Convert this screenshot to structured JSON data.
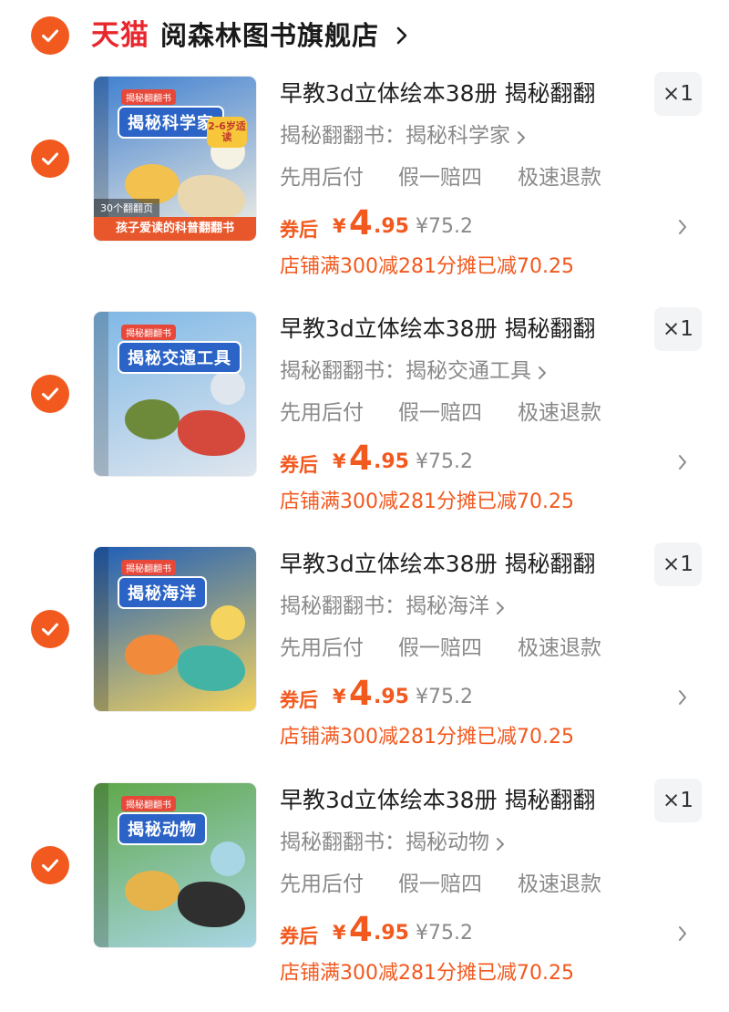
{
  "store": {
    "brand_logo_text": "天猫",
    "name": "阅森林图书旗舰店",
    "chevron": "chevron-right-icon",
    "checked": true
  },
  "colors": {
    "accent": "#f2591f",
    "brand_red": "#e8262d",
    "muted_text": "#8a8a8a",
    "qty_bg": "#f3f4f6"
  },
  "items": [
    {
      "checked": true,
      "title": "早教3d立体绘本38册 揭秘翻翻",
      "quantity": "×1",
      "sku": "揭秘翻翻书：揭秘科学家",
      "services": [
        "先用后付",
        "假一赔四",
        "极速退款"
      ],
      "coupon_label": "券后",
      "currency": "¥",
      "price_int": "4",
      "price_dec": ".95",
      "original_price": "¥75.2",
      "promo": "店铺满300减281分摊已减70.25",
      "cover": {
        "title": "揭秘科学家",
        "mini_tag": "揭秘翻翻书",
        "badge": "2-6岁适读",
        "ribbon_top": "30个翻翻页",
        "ribbon_bottom": "孩子爱读的科普翻翻书",
        "bg": "#3f7fd0",
        "accent1": "#f2c14e",
        "accent2": "#e9d7b0",
        "accent3": "#f5f1e3"
      }
    },
    {
      "checked": true,
      "title": "早教3d立体绘本38册 揭秘翻翻",
      "quantity": "×1",
      "sku": "揭秘翻翻书：揭秘交通工具",
      "services": [
        "先用后付",
        "假一赔四",
        "极速退款"
      ],
      "coupon_label": "券后",
      "currency": "¥",
      "price_int": "4",
      "price_dec": ".95",
      "original_price": "¥75.2",
      "promo": "店铺满300减281分摊已减70.25",
      "cover": {
        "title": "揭秘交通工具",
        "mini_tag": "揭秘翻翻书",
        "badge": "",
        "ribbon_top": "",
        "ribbon_bottom": "",
        "bg": "#7fb8e6",
        "accent1": "#6c8a3a",
        "accent2": "#d4493b",
        "accent3": "#dfe6ee"
      }
    },
    {
      "checked": true,
      "title": "早教3d立体绘本38册 揭秘翻翻",
      "quantity": "×1",
      "sku": "揭秘翻翻书：揭秘海洋",
      "services": [
        "先用后付",
        "假一赔四",
        "极速退款"
      ],
      "coupon_label": "券后",
      "currency": "¥",
      "price_int": "4",
      "price_dec": ".95",
      "original_price": "¥75.2",
      "promo": "店铺满300减281分摊已减70.25",
      "cover": {
        "title": "揭秘海洋",
        "mini_tag": "揭秘翻翻书",
        "badge": "",
        "ribbon_top": "",
        "ribbon_bottom": "",
        "bg": "#1f5fb8",
        "accent1": "#f28a3c",
        "accent2": "#43b3a6",
        "accent3": "#f4d35e"
      }
    },
    {
      "checked": true,
      "title": "早教3d立体绘本38册 揭秘翻翻",
      "quantity": "×1",
      "sku": "揭秘翻翻书：揭秘动物",
      "services": [
        "先用后付",
        "假一赔四",
        "极速退款"
      ],
      "coupon_label": "券后",
      "currency": "¥",
      "price_int": "4",
      "price_dec": ".95",
      "original_price": "¥75.2",
      "promo": "店铺满300减281分摊已减70.25",
      "cover": {
        "title": "揭秘动物",
        "mini_tag": "揭秘翻翻书",
        "badge": "",
        "ribbon_top": "",
        "ribbon_bottom": "",
        "bg": "#5fa84a",
        "accent1": "#e6b34a",
        "accent2": "#2f2f2f",
        "accent3": "#a9d6e5"
      }
    }
  ]
}
